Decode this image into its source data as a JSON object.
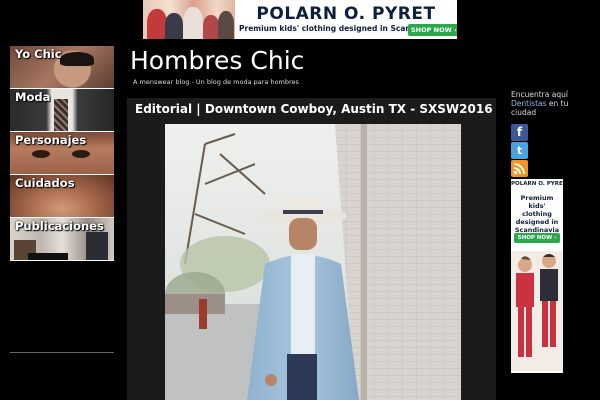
{
  "top_ad": {
    "brand": "POLARN O. PYRET",
    "tagline": "Premium kids' clothing designed in Scandinavia",
    "cta": "SHOP NOW ›"
  },
  "nav": {
    "items": [
      {
        "label": "Yo Chic"
      },
      {
        "label": "Moda"
      },
      {
        "label": "Personajes"
      },
      {
        "label": "Cuidados"
      },
      {
        "label": "Publicaciones"
      }
    ]
  },
  "header": {
    "title": "Hombres Chic",
    "tagline": "A menswear blog - Un blog de moda para hombres"
  },
  "post": {
    "title": "Editorial | Downtown Cowboy, Austin TX - SXSW2016"
  },
  "sidebar": {
    "text_before": "Encuentra aquí",
    "link_text": "Dentistas",
    "text_after": "en tu ciudad",
    "icons": [
      "facebook-icon",
      "twitter-icon",
      "rss-icon"
    ]
  },
  "side_ad": {
    "brand": "POLARN O. PYRET",
    "tagline": "Premium kids' clothing designed in Scandinavia",
    "cta": "SHOP NOW ›"
  }
}
